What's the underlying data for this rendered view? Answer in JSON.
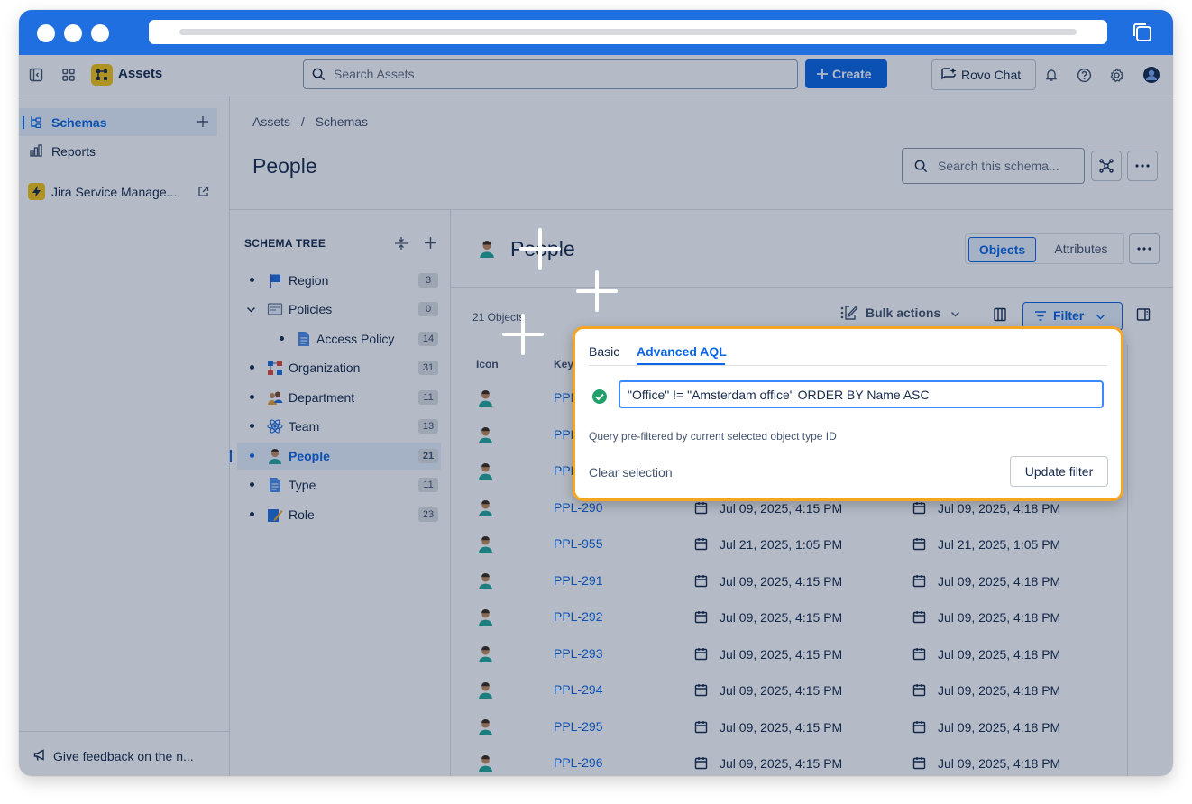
{
  "topbar": {
    "app_name": "Assets",
    "search_placeholder": "Search Assets",
    "create_label": "Create",
    "rovo_label": "Rovo Chat"
  },
  "sidebar": {
    "items": [
      {
        "label": "Schemas",
        "icon": "schema-icon",
        "active": true
      },
      {
        "label": "Reports",
        "icon": "reports-icon"
      }
    ],
    "app_link": "Jira Service Manage...",
    "feedback": "Give feedback on the n..."
  },
  "breadcrumb": [
    "Assets",
    "Schemas"
  ],
  "page": {
    "title": "People",
    "search_placeholder": "Search this schema..."
  },
  "schema_tree": {
    "heading": "SCHEMA TREE",
    "items": [
      {
        "label": "Region",
        "count": "3",
        "icon": "flag-icon"
      },
      {
        "label": "Policies",
        "count": "0",
        "icon": "certificate-icon",
        "expanded": true
      },
      {
        "label": "Access Policy",
        "count": "14",
        "icon": "document-icon",
        "child": true
      },
      {
        "label": "Organization",
        "count": "31",
        "icon": "org-chart-icon"
      },
      {
        "label": "Department",
        "count": "11",
        "icon": "group-icon"
      },
      {
        "label": "Team",
        "count": "13",
        "icon": "atom-icon"
      },
      {
        "label": "People",
        "count": "21",
        "icon": "person-icon",
        "active": true
      },
      {
        "label": "Type",
        "count": "11",
        "icon": "document-icon"
      },
      {
        "label": "Role",
        "count": "23",
        "icon": "pencil-icon"
      }
    ]
  },
  "object_view": {
    "title": "People",
    "tabs": [
      "Objects",
      "Attributes"
    ],
    "count_text": "21 Objects",
    "bulk_label": "Bulk actions",
    "filter_label": "Filter",
    "columns": [
      "Icon",
      "Key"
    ],
    "rows": [
      {
        "key": "PPL",
        "created": "",
        "updated": ""
      },
      {
        "key": "PPL",
        "created": "",
        "updated": ""
      },
      {
        "key": "PPL",
        "created": "",
        "updated": ""
      },
      {
        "key": "PPL-290",
        "created": "Jul 09, 2025, 4:15 PM",
        "updated": "Jul 09, 2025, 4:18 PM"
      },
      {
        "key": "PPL-955",
        "created": "Jul 21, 2025, 1:05 PM",
        "updated": "Jul 21, 2025, 1:05 PM"
      },
      {
        "key": "PPL-291",
        "created": "Jul 09, 2025, 4:15 PM",
        "updated": "Jul 09, 2025, 4:18 PM"
      },
      {
        "key": "PPL-292",
        "created": "Jul 09, 2025, 4:15 PM",
        "updated": "Jul 09, 2025, 4:18 PM"
      },
      {
        "key": "PPL-293",
        "created": "Jul 09, 2025, 4:15 PM",
        "updated": "Jul 09, 2025, 4:18 PM"
      },
      {
        "key": "PPL-294",
        "created": "Jul 09, 2025, 4:15 PM",
        "updated": "Jul 09, 2025, 4:18 PM"
      },
      {
        "key": "PPL-295",
        "created": "Jul 09, 2025, 4:15 PM",
        "updated": "Jul 09, 2025, 4:18 PM"
      },
      {
        "key": "PPL-296",
        "created": "Jul 09, 2025, 4:15 PM",
        "updated": "Jul 09, 2025, 4:18 PM"
      }
    ]
  },
  "filter_popup": {
    "tabs": [
      "Basic",
      "Advanced AQL"
    ],
    "active_tab": "Advanced AQL",
    "query": "\"Office\" != \"Amsterdam office\" ORDER BY Name ASC",
    "hint": "Query pre-filtered by current selected object type ID",
    "clear_label": "Clear selection",
    "update_label": "Update filter"
  },
  "colors": {
    "brand_blue": "#0c66e4",
    "chrome_blue": "#1f6fe0",
    "highlight_orange": "#f5a623",
    "logo_yellow": "#f5c518",
    "success_green": "#22a06b"
  }
}
